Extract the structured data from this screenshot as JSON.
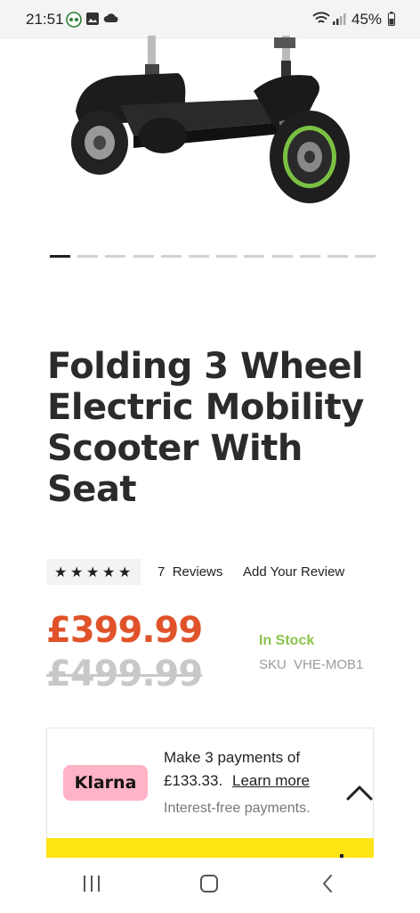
{
  "status_bar": {
    "time": "21:51",
    "battery": "45%",
    "icons": [
      "eye-notification-icon",
      "gallery-icon",
      "cloud-icon",
      "wifi-icon",
      "signal-icon",
      "battery-icon"
    ]
  },
  "product": {
    "image_icon": "scooter-image",
    "gallery": {
      "total_slides": 12,
      "active_index": 0
    },
    "title": "Folding 3 Wheel Electric Mobility Scooter With Seat",
    "rating": {
      "stars": 5,
      "max_stars": 5,
      "review_count": "7",
      "reviews_label": "Reviews",
      "add_review_label": "Add Your Review"
    },
    "price": "£399.99",
    "old_price": "£499.99",
    "stock_status": "In Stock",
    "sku_label": "SKU",
    "sku_value": "VHE-MOB1"
  },
  "klarna": {
    "logo_text": "Klarna",
    "line1": "Make 3 payments of",
    "amount": "£133.33.",
    "learn_more": "Learn more",
    "line3": "Interest-free payments."
  },
  "nav": {
    "icons": [
      "recent-apps-icon",
      "home-icon",
      "back-icon"
    ]
  },
  "colors": {
    "price": "#e0532a",
    "old_price": "#c8c8c8",
    "in_stock": "#8bc34a",
    "klarna_pink": "#ffb3c7",
    "banner_yellow": "#ffe414"
  }
}
